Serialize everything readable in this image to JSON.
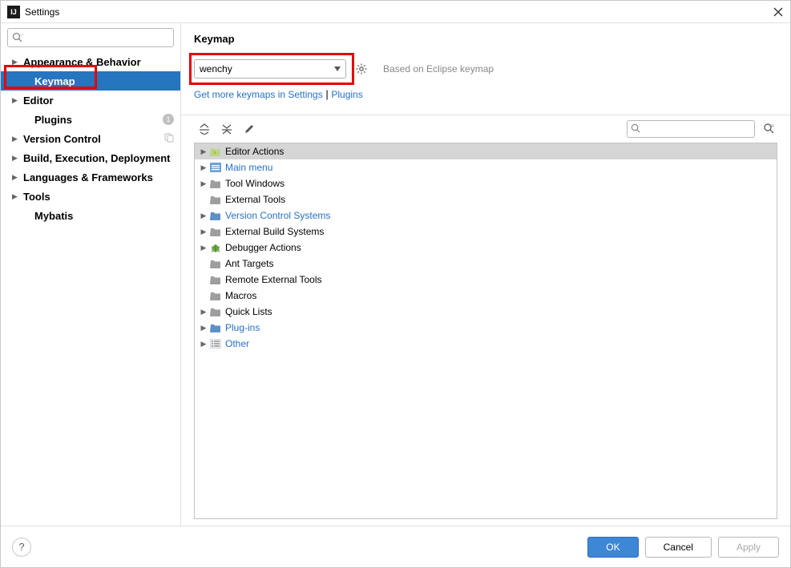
{
  "window": {
    "title": "Settings",
    "icon_text": "IJ"
  },
  "sidebar": {
    "search_placeholder": "",
    "items": [
      {
        "label": "Appearance & Behavior",
        "expandable": true,
        "indent": false
      },
      {
        "label": "Keymap",
        "expandable": false,
        "active": true,
        "indent": true
      },
      {
        "label": "Editor",
        "expandable": true,
        "indent": false
      },
      {
        "label": "Plugins",
        "expandable": false,
        "indent": true,
        "badge": "1"
      },
      {
        "label": "Version Control",
        "expandable": true,
        "indent": false,
        "trailing_icon": "copy-icon"
      },
      {
        "label": "Build, Execution, Deployment",
        "expandable": true,
        "indent": false
      },
      {
        "label": "Languages & Frameworks",
        "expandable": true,
        "indent": false
      },
      {
        "label": "Tools",
        "expandable": true,
        "indent": false
      },
      {
        "label": "Mybatis",
        "expandable": false,
        "indent": true
      }
    ]
  },
  "content": {
    "heading": "Keymap",
    "select_value": "wenchy",
    "based_on": "Based on Eclipse keymap",
    "link_text_1": "Get more keymaps in Settings",
    "link_sep": " | ",
    "link_text_2": "Plugins",
    "tree_search_placeholder": ""
  },
  "tree": [
    {
      "label": "Editor Actions",
      "expandable": true,
      "icon": "folder-special",
      "selected": true
    },
    {
      "label": "Main menu",
      "expandable": true,
      "icon": "menu-icon",
      "link": true
    },
    {
      "label": "Tool Windows",
      "expandable": true,
      "icon": "folder-gray"
    },
    {
      "label": "External Tools",
      "expandable": false,
      "icon": "folder-gray"
    },
    {
      "label": "Version Control Systems",
      "expandable": true,
      "icon": "folder-blue",
      "link": true
    },
    {
      "label": "External Build Systems",
      "expandable": true,
      "icon": "folder-gray"
    },
    {
      "label": "Debugger Actions",
      "expandable": true,
      "icon": "bug-icon"
    },
    {
      "label": "Ant Targets",
      "expandable": false,
      "icon": "folder-gray"
    },
    {
      "label": "Remote External Tools",
      "expandable": false,
      "icon": "folder-gray"
    },
    {
      "label": "Macros",
      "expandable": false,
      "icon": "folder-gray"
    },
    {
      "label": "Quick Lists",
      "expandable": true,
      "icon": "folder-gray"
    },
    {
      "label": "Plug-ins",
      "expandable": true,
      "icon": "folder-blue",
      "link": true
    },
    {
      "label": "Other",
      "expandable": true,
      "icon": "list-icon",
      "link": true
    }
  ],
  "buttons": {
    "ok": "OK",
    "cancel": "Cancel",
    "apply": "Apply"
  }
}
